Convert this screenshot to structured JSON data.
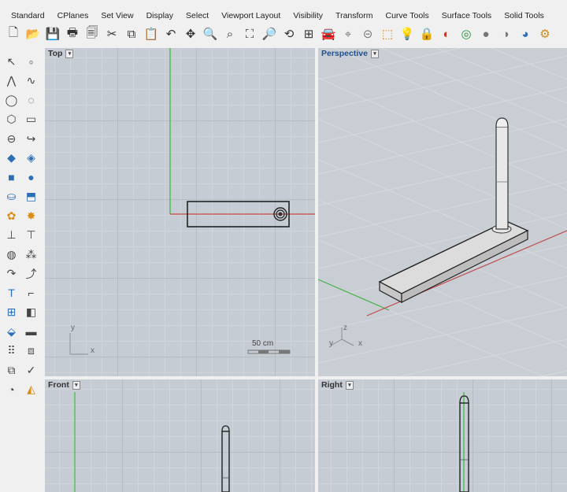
{
  "tabs": [
    "Standard",
    "CPlanes",
    "Set View",
    "Display",
    "Select",
    "Viewport Layout",
    "Visibility",
    "Transform",
    "Curve Tools",
    "Surface Tools",
    "Solid Tools"
  ],
  "toolbar": [
    {
      "name": "new-icon",
      "glyph": "🗋",
      "tone": ""
    },
    {
      "name": "open-icon",
      "glyph": "📂",
      "tone": "orange"
    },
    {
      "name": "save-icon",
      "glyph": "💾",
      "tone": ""
    },
    {
      "name": "print-icon",
      "glyph": "🖶",
      "tone": ""
    },
    {
      "name": "import-icon",
      "glyph": "🗐",
      "tone": ""
    },
    {
      "name": "cut-icon",
      "glyph": "✂",
      "tone": ""
    },
    {
      "name": "copy-icon",
      "glyph": "⧉",
      "tone": ""
    },
    {
      "name": "paste-icon",
      "glyph": "📋",
      "tone": "orange"
    },
    {
      "name": "undo-icon",
      "glyph": "↶",
      "tone": ""
    },
    {
      "name": "pan-icon",
      "glyph": "✥",
      "tone": ""
    },
    {
      "name": "zoom-icon",
      "glyph": "🔍",
      "tone": ""
    },
    {
      "name": "zoom-window-icon",
      "glyph": "⌕",
      "tone": ""
    },
    {
      "name": "zoom-extents-icon",
      "glyph": "⛶",
      "tone": ""
    },
    {
      "name": "zoom-selected-icon",
      "glyph": "🔎",
      "tone": ""
    },
    {
      "name": "rotate-view-icon",
      "glyph": "⟲",
      "tone": ""
    },
    {
      "name": "four-viewports-icon",
      "glyph": "⊞",
      "tone": ""
    },
    {
      "name": "car-icon",
      "glyph": "🚘",
      "tone": "red"
    },
    {
      "name": "snap-icon",
      "glyph": "⌖",
      "tone": "gray"
    },
    {
      "name": "cplane-icon",
      "glyph": "⊝",
      "tone": "gray"
    },
    {
      "name": "select-icon",
      "glyph": "⬚",
      "tone": "orange"
    },
    {
      "name": "light-bulb-icon",
      "glyph": "💡",
      "tone": ""
    },
    {
      "name": "lock-icon",
      "glyph": "🔒",
      "tone": ""
    },
    {
      "name": "material-icon",
      "glyph": "◐",
      "tone": "red"
    },
    {
      "name": "color-wheel-icon",
      "glyph": "◎",
      "tone": "green"
    },
    {
      "name": "render-icon",
      "glyph": "●",
      "tone": "gray"
    },
    {
      "name": "render-preview-icon",
      "glyph": "◑",
      "tone": "gray"
    },
    {
      "name": "rendered-sphere-icon",
      "glyph": "◕",
      "tone": "blue"
    },
    {
      "name": "options-icon",
      "glyph": "⚙",
      "tone": "orange"
    }
  ],
  "palette": [
    [
      {
        "name": "select-arrow-icon",
        "glyph": "↖"
      },
      {
        "name": "point-icon",
        "glyph": "∘",
        "tone": "gray"
      }
    ],
    [
      {
        "name": "polyline-icon",
        "glyph": "⋀"
      },
      {
        "name": "curve-icon",
        "glyph": "∿"
      }
    ],
    [
      {
        "name": "circle-icon",
        "glyph": "◯"
      },
      {
        "name": "arc-icon",
        "glyph": "◌"
      }
    ],
    [
      {
        "name": "polygon-icon",
        "glyph": "⬡"
      },
      {
        "name": "rectangle-icon",
        "glyph": "▭"
      }
    ],
    [
      {
        "name": "ellipse-icon",
        "glyph": "⊖"
      },
      {
        "name": "fillet-icon",
        "glyph": "↪"
      }
    ],
    [
      {
        "name": "surface-icon",
        "glyph": "◆",
        "tone": "blue"
      },
      {
        "name": "loft-icon",
        "glyph": "◈",
        "tone": "blue"
      }
    ],
    [
      {
        "name": "box-icon",
        "glyph": "■",
        "tone": "blue"
      },
      {
        "name": "sphere-icon",
        "glyph": "●",
        "tone": "blue"
      }
    ],
    [
      {
        "name": "cylinder-icon",
        "glyph": "⛀",
        "tone": "blue"
      },
      {
        "name": "extrude-icon",
        "glyph": "⬒",
        "tone": "blue"
      }
    ],
    [
      {
        "name": "mesh-icon",
        "glyph": "✿",
        "tone": "orange"
      },
      {
        "name": "explode-icon",
        "glyph": "✸",
        "tone": "orange"
      }
    ],
    [
      {
        "name": "split-icon",
        "glyph": "⊥"
      },
      {
        "name": "trim-icon",
        "glyph": "⊤"
      }
    ],
    [
      {
        "name": "boolean-icon",
        "glyph": "◍"
      },
      {
        "name": "join-icon",
        "glyph": "⁂"
      }
    ],
    [
      {
        "name": "offset-icon",
        "glyph": "↷"
      },
      {
        "name": "rebuild-icon",
        "glyph": "⤴"
      }
    ],
    [
      {
        "name": "text-icon",
        "glyph": "T",
        "tone": "blue"
      },
      {
        "name": "dimension-icon",
        "glyph": "⌐"
      }
    ],
    [
      {
        "name": "array-icon",
        "glyph": "⊞",
        "tone": "blue"
      },
      {
        "name": "mirror-icon",
        "glyph": "◧"
      }
    ],
    [
      {
        "name": "transform-icon",
        "glyph": "⬙",
        "tone": "blue"
      },
      {
        "name": "analyze-icon",
        "glyph": "▬"
      }
    ],
    [
      {
        "name": "grid-array-icon",
        "glyph": "⠿"
      },
      {
        "name": "group-icon",
        "glyph": "⧈"
      }
    ],
    [
      {
        "name": "layer-icon",
        "glyph": "⧉"
      },
      {
        "name": "check-icon",
        "glyph": "✓"
      }
    ],
    [
      {
        "name": "render-mesh-icon",
        "glyph": "◔"
      },
      {
        "name": "paint-icon",
        "glyph": "◭",
        "tone": "orange"
      }
    ]
  ],
  "viewports": {
    "top": {
      "label": "Top",
      "scale_label": "50 cm",
      "axis_y": "y",
      "axis_x": "x"
    },
    "perspective": {
      "label": "Perspective",
      "axis_z": "z",
      "axis_y": "y",
      "axis_x": "x"
    },
    "front": {
      "label": "Front"
    },
    "right": {
      "label": "Right"
    }
  },
  "caret": "▾"
}
